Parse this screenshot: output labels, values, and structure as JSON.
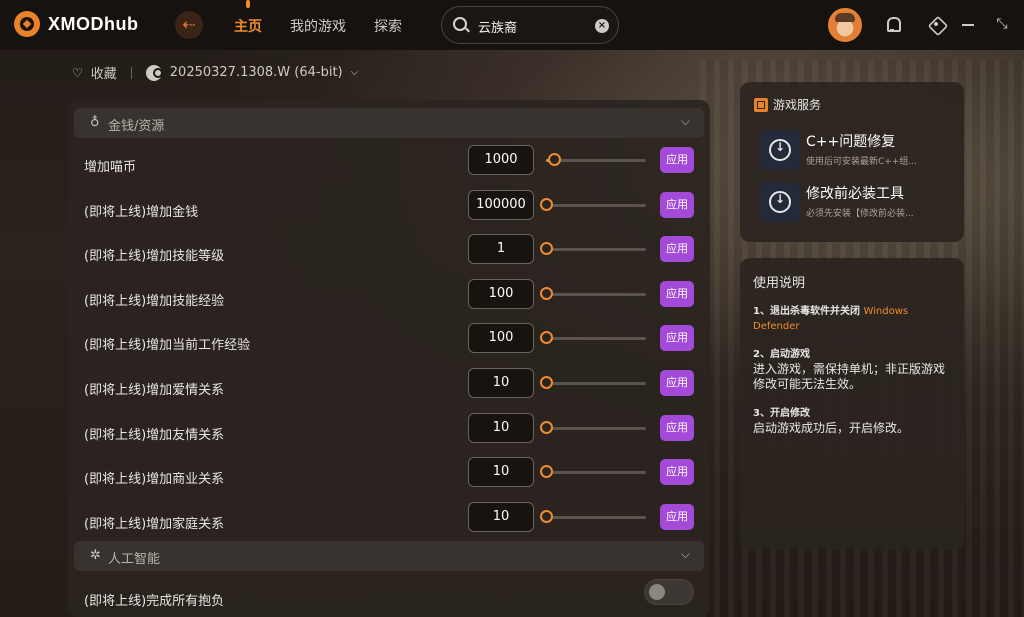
{
  "app": {
    "name": "XMODhub",
    "accent": "#f08a2f",
    "apply_color": "#a34ad8"
  },
  "nav": {
    "items": [
      {
        "label": "主页",
        "active": true
      },
      {
        "label": "我的游戏",
        "active": false
      },
      {
        "label": "探索",
        "active": false
      }
    ]
  },
  "search": {
    "value": "云族裔",
    "clear": "×"
  },
  "window": {
    "maximize": "⤡"
  },
  "game": {
    "favorite_label": "收藏",
    "version_label": "20250327.1308.W (64-bit)"
  },
  "sections": [
    {
      "title": "金钱/资源",
      "rows": [
        {
          "label": "增加喵币",
          "value": "1000",
          "level": 0.08,
          "apply": "应用"
        },
        {
          "label": "(即将上线)增加金钱",
          "value": "100000",
          "level": 0,
          "apply": "应用"
        },
        {
          "label": "(即将上线)增加技能等级",
          "value": "1",
          "level": 0,
          "apply": "应用"
        },
        {
          "label": "(即将上线)增加技能经验",
          "value": "100",
          "level": 0,
          "apply": "应用"
        },
        {
          "label": "(即将上线)增加当前工作经验",
          "value": "100",
          "level": 0,
          "apply": "应用"
        },
        {
          "label": "(即将上线)增加爱情关系",
          "value": "10",
          "level": 0,
          "apply": "应用"
        },
        {
          "label": "(即将上线)增加友情关系",
          "value": "10",
          "level": 0,
          "apply": "应用"
        },
        {
          "label": "(即将上线)增加商业关系",
          "value": "10",
          "level": 0,
          "apply": "应用"
        },
        {
          "label": "(即将上线)增加家庭关系",
          "value": "10",
          "level": 0,
          "apply": "应用"
        }
      ]
    },
    {
      "title": "人工智能",
      "rows": [
        {
          "label": "(即将上线)完成所有抱负",
          "toggle": false
        }
      ]
    }
  ],
  "services": {
    "title": "游戏服务",
    "items": [
      {
        "title": "C++问题修复",
        "subtitle": "使用后可安装最新C++组..."
      },
      {
        "title": "修改前必装工具",
        "subtitle": "必须先安装【修改前必装..."
      }
    ]
  },
  "usage": {
    "title": "使用说明",
    "steps": [
      {
        "heading": "1、退出杀毒软件并关闭",
        "highlight": "Windows Defender",
        "body": ""
      },
      {
        "heading": "2、启动游戏",
        "highlight": "",
        "body": "进入游戏，需保持单机；非正版游戏修改可能无法生效。"
      },
      {
        "heading": "3、开启修改",
        "highlight": "",
        "body": "启动游戏成功后，开启修改。"
      }
    ]
  }
}
